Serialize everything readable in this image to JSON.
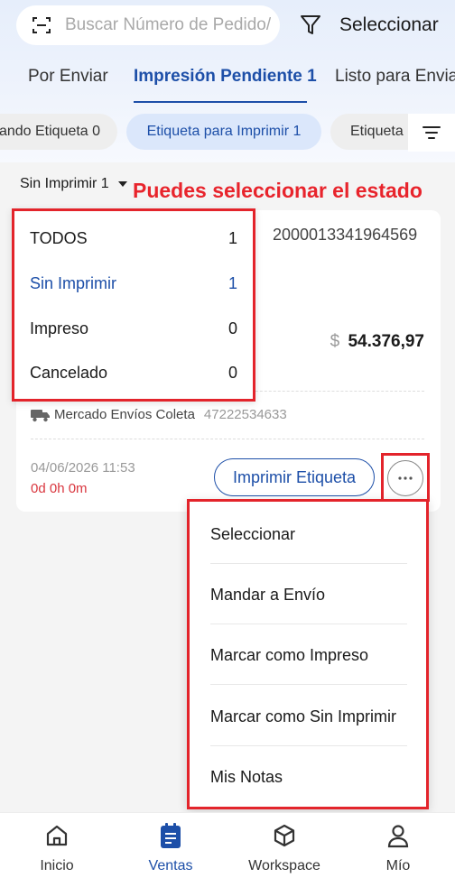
{
  "search": {
    "placeholder": "Buscar Número de Pedido/"
  },
  "filter": {
    "label": "Seleccionar"
  },
  "tabs": [
    {
      "label": "Por Enviar"
    },
    {
      "label": "Impresión Pendiente 1"
    },
    {
      "label": "Listo para Envia"
    }
  ],
  "chips": [
    {
      "label": "ando Etiqueta 0"
    },
    {
      "label": "Etiqueta para Imprimir 1"
    },
    {
      "label": "Etiqueta"
    }
  ],
  "status_filter": {
    "label": "Sin Imprimir 1"
  },
  "annotation": "Puedes seleccionar el estado",
  "status_options": [
    {
      "label": "TODOS",
      "count": "1"
    },
    {
      "label": "Sin Imprimir",
      "count": "1"
    },
    {
      "label": "Impreso",
      "count": "0"
    },
    {
      "label": "Cancelado",
      "count": "0"
    }
  ],
  "order": {
    "number": "2000013341964569",
    "currency": "$",
    "amount": "54.376,97",
    "carrier": "Mercado Envíos Coleta",
    "tracking": "47222534633",
    "date": "04/06/2026 11:53",
    "elapsed": "0d 0h 0m",
    "print_label": "Imprimir Etiqueta"
  },
  "actions": [
    {
      "label": "Seleccionar"
    },
    {
      "label": "Mandar a Envío"
    },
    {
      "label": "Marcar como Impreso"
    },
    {
      "label": "Marcar como Sin Imprimir"
    },
    {
      "label": "Mis Notas"
    }
  ],
  "nav": [
    {
      "label": "Inicio",
      "icon": "home-icon"
    },
    {
      "label": "Ventas",
      "icon": "sales-icon"
    },
    {
      "label": "Workspace",
      "icon": "cube-icon"
    },
    {
      "label": "Mío",
      "icon": "user-icon"
    }
  ],
  "colors": {
    "accent": "#1d4fa8",
    "highlight_red": "#e3242b",
    "elapsed_red": "#d9363e"
  }
}
